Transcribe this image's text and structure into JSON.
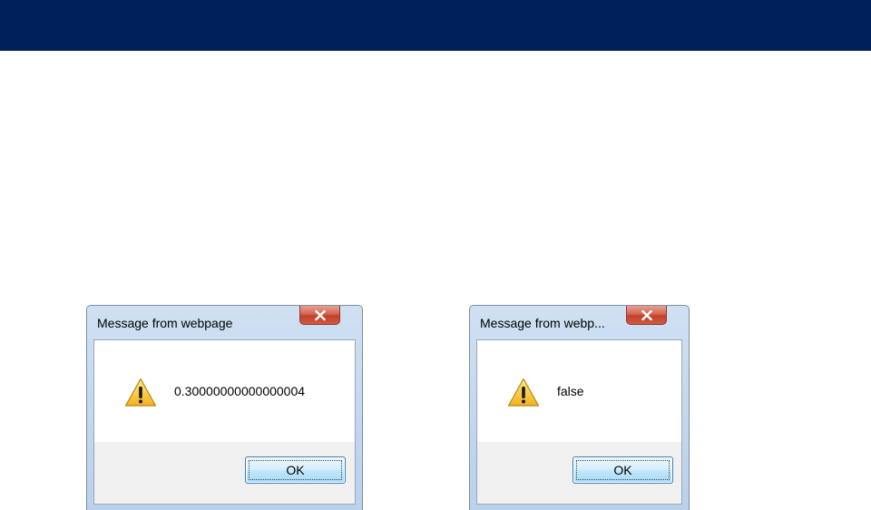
{
  "colors": {
    "top_bar": "#00205b",
    "dialog_frame": "#b9d1ea",
    "close_button": "#c2412b",
    "ok_button": "#bee6fd"
  },
  "dialogs": [
    {
      "title": "Message from webpage",
      "icon": "warning-icon",
      "message": "0.30000000000000004",
      "ok_label": "OK",
      "close_icon": "close-icon"
    },
    {
      "title": "Message from webp...",
      "icon": "warning-icon",
      "message": "false",
      "ok_label": "OK",
      "close_icon": "close-icon"
    }
  ]
}
